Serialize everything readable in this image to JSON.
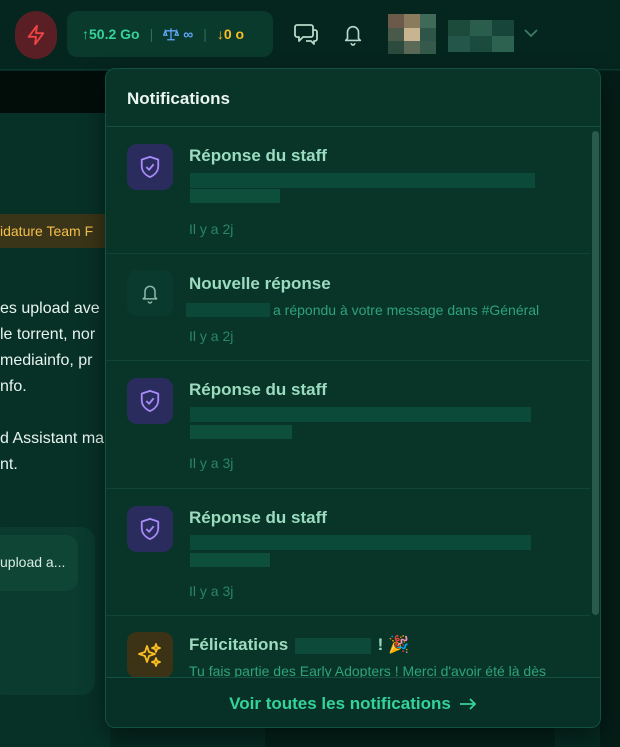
{
  "topbar": {
    "bolt_icon": "lightning-bolt-icon",
    "stats": {
      "upload": "↑50.2 Go",
      "ratio_icon": "scale-balance-icon",
      "ratio": "∞",
      "download": "↓0 o",
      "separator": "|"
    },
    "chat_icon": "chat-bubbles-icon",
    "bell_icon": "bell-icon",
    "menu_icon": "chevron-down-icon"
  },
  "background": {
    "banner_text": "idature Team F",
    "paragraph_lines": [
      "es upload ave",
      "le torrent, nor",
      " mediainfo, pr",
      "nfo."
    ],
    "paragraph2_lines": [
      "d Assistant ma",
      "nt."
    ],
    "pill_text": "upload a..."
  },
  "notifications": {
    "title": "Notifications",
    "items": [
      {
        "type": "staff",
        "icon": "shield-check-icon",
        "title": "Réponse du staff",
        "time": "Il y a 2j"
      },
      {
        "type": "reply",
        "icon": "bell-icon",
        "title": "Nouvelle réponse",
        "message": "a répondu à votre message dans #Général",
        "time": "Il y a 2j"
      },
      {
        "type": "staff",
        "icon": "shield-check-icon",
        "title": "Réponse du staff",
        "time": "Il y a 3j"
      },
      {
        "type": "staff",
        "icon": "shield-check-icon",
        "title": "Réponse du staff",
        "time": "Il y a 3j"
      },
      {
        "type": "congrats",
        "icon": "sparkles-icon",
        "title": "Félicitations",
        "title_suffix": "! 🎉",
        "message": "Tu fais partie des Early Adopters ! Merci d'avoir été là dès"
      }
    ],
    "footer_label": "Voir toutes les notifications",
    "footer_icon": "arrow-right-icon"
  },
  "colors": {
    "accent": "#34d399",
    "staff_icon": "#a78bfa",
    "congrats_icon": "#fbbf24",
    "bolt": "#ef4444"
  }
}
